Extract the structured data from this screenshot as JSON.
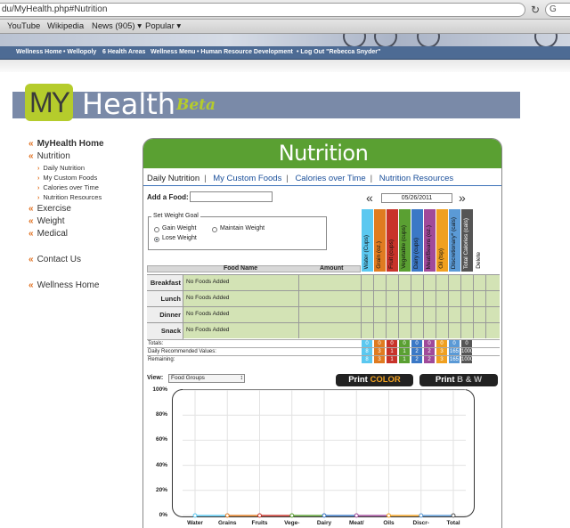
{
  "browser": {
    "url": "du/MyHealth.php#Nutrition",
    "search_placeholder": "G",
    "bookmarks": [
      "YouTube",
      "Wikipedia",
      "News (905) ▾",
      "Popular ▾"
    ]
  },
  "site_nav": {
    "items": [
      "Wellness Home",
      "• Wellopoly",
      "6 Health Areas",
      "Wellness Menu",
      "• Human Resource Development",
      "• Log Out \"Rebecca Snyder\""
    ]
  },
  "logo": {
    "my": "MY",
    "health": "Health",
    "beta": "Beta",
    "accent": "#b5cc2c",
    "band_color": "#7a8aa8"
  },
  "sidebar": {
    "main": [
      "MyHealth Home",
      "Nutrition"
    ],
    "sub": [
      "Daily Nutrition",
      "My Custom Foods",
      "Calories over Time",
      "Nutrition Resources"
    ],
    "other": [
      "Exercise",
      "Weight",
      "Medical"
    ],
    "contact": "Contact Us",
    "wellness": "Wellness Home"
  },
  "panel": {
    "title": "Nutrition",
    "header_color": "#5aa032",
    "tabs": [
      "Daily Nutrition",
      "My Custom Foods",
      "Calories over Time",
      "Nutrition Resources"
    ],
    "add_food_label": "Add a Food:",
    "date": "05/26/2011",
    "goal_legend": "Set Weight Goal",
    "goal_options": [
      "Gain Weight",
      "Maintain Weight",
      "Lose Weight"
    ],
    "goal_selected": "Lose Weight",
    "grid_headers": {
      "food": "Food Name",
      "amount": "Amount"
    },
    "columns": [
      {
        "label": "Water (Cups)",
        "color": "#5bc8f0"
      },
      {
        "label": "Grain (oz.)",
        "color": "#e07b20"
      },
      {
        "label": "Fruit (cups)",
        "color": "#c8332a"
      },
      {
        "label": "Vegetable (cups)",
        "color": "#5aa032"
      },
      {
        "label": "Dairy (cups)",
        "color": "#3b78c6"
      },
      {
        "label": "Meat/Beans (oz.)",
        "color": "#a04a9a"
      },
      {
        "label": "Oil (tsp)",
        "color": "#f0a020"
      },
      {
        "label": "Discretionary* (cals)",
        "color": "#5b9ad6"
      },
      {
        "label": "Total Calories (cals)",
        "color": "#555555"
      },
      {
        "label": "Delete",
        "color": "#ffffff"
      }
    ],
    "meals": [
      {
        "name": "Breakfast",
        "value": "No Foods Added"
      },
      {
        "name": "Lunch",
        "value": "No Foods Added"
      },
      {
        "name": "Dinner",
        "value": "No Foods Added"
      },
      {
        "name": "Snack",
        "value": "No Foods Added"
      }
    ],
    "summary": [
      {
        "label": "Totals:",
        "values": [
          "0",
          "0",
          "0",
          "0",
          "0",
          "0",
          "0",
          "0",
          "0"
        ]
      },
      {
        "label": "Daily Recommended Values:",
        "values": [
          "8",
          "3",
          "1",
          "1",
          "2",
          "2",
          "3",
          "165",
          "1000"
        ]
      },
      {
        "label": "Remaining:",
        "values": [
          "8",
          "3",
          "1",
          "1",
          "2",
          "2",
          "3",
          "165",
          "1000"
        ]
      }
    ],
    "view_label": "View:",
    "view_selected": "Food Groups",
    "print_color": {
      "word": "Print",
      "accent": "COLOR"
    },
    "print_bw": {
      "word": "Print",
      "accent": "B & W"
    }
  },
  "chart_data": {
    "type": "line",
    "title": "",
    "xlabel": "",
    "ylabel": "",
    "ylim": [
      0,
      100
    ],
    "yticks": [
      "100%",
      "80%",
      "60%",
      "40%",
      "20%",
      "0%"
    ],
    "categories": [
      "Water",
      "Grains",
      "Fruits",
      "Vege-",
      "Dairy",
      "Meat/",
      "Oils",
      "Discr-",
      "Total"
    ],
    "values": [
      0,
      0,
      0,
      0,
      0,
      0,
      0,
      0,
      0
    ],
    "point_colors": [
      "#5bc8f0",
      "#e07b20",
      "#c8332a",
      "#5aa032",
      "#3b78c6",
      "#a04a9a",
      "#f0a020",
      "#5b9ad6",
      "#555555"
    ],
    "grid": true
  }
}
